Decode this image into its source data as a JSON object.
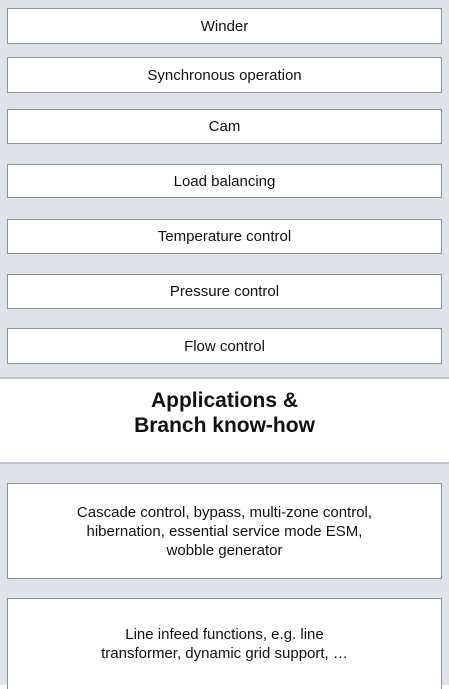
{
  "functions": {
    "items": [
      {
        "label": "Winder"
      },
      {
        "label": "Synchronous operation"
      },
      {
        "label": "Cam"
      },
      {
        "label": "Load balancing"
      },
      {
        "label": "Temperature control"
      },
      {
        "label": "Pressure control"
      },
      {
        "label": "Flow control"
      }
    ]
  },
  "heading": {
    "line1": "Applications &",
    "line2": "Branch know-how"
  },
  "branch": {
    "box1_lines": [
      "Cascade control, bypass, multi-zone control,",
      "hibernation, essential service mode ESM,",
      "wobble generator"
    ],
    "box2_lines": [
      "Line infeed functions, e.g. line",
      "transformer, dynamic grid support, …"
    ]
  }
}
